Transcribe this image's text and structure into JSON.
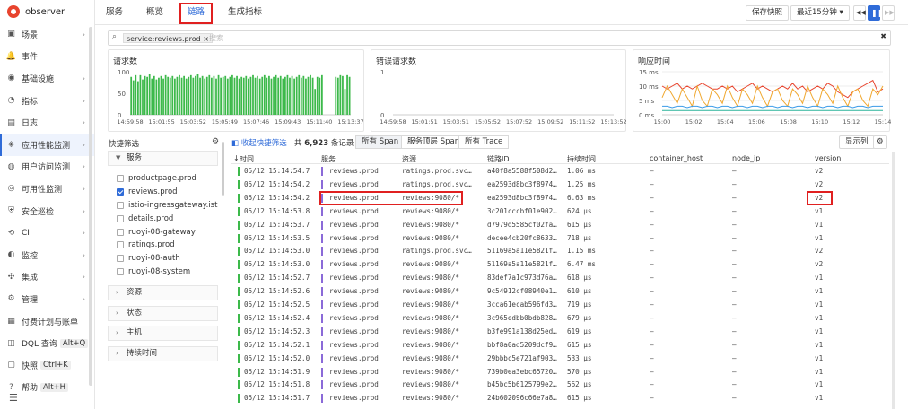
{
  "app": {
    "name": "observer"
  },
  "nav": {
    "items": [
      {
        "label": "场景",
        "icon": "dashboard-icon",
        "arrow": true
      },
      {
        "label": "事件",
        "icon": "bell-icon",
        "arrow": false
      },
      {
        "label": "基础设施",
        "icon": "server-icon",
        "arrow": true
      },
      {
        "label": "指标",
        "icon": "metric-icon",
        "arrow": true
      },
      {
        "label": "日志",
        "icon": "log-icon",
        "arrow": true
      },
      {
        "label": "应用性能监测",
        "icon": "apm-icon",
        "arrow": true,
        "active": true
      },
      {
        "label": "用户访问监测",
        "icon": "user-icon",
        "arrow": true
      },
      {
        "label": "可用性监测",
        "icon": "globe-icon",
        "arrow": true
      },
      {
        "label": "安全巡检",
        "icon": "shield-icon",
        "arrow": true
      },
      {
        "label": "CI",
        "icon": "ci-icon",
        "arrow": true
      },
      {
        "label": "监控",
        "icon": "monitor-icon",
        "arrow": true
      },
      {
        "label": "集成",
        "icon": "integration-icon",
        "arrow": true
      },
      {
        "label": "管理",
        "icon": "settings-icon",
        "arrow": true
      },
      {
        "label": "付费计划与账单",
        "icon": "billing-icon",
        "arrow": false
      },
      {
        "label": "DQL 查询",
        "icon": "dql-icon",
        "kbd": "Alt+Q"
      },
      {
        "label": "快照",
        "icon": "snapshot-icon",
        "kbd": "Ctrl+K"
      },
      {
        "label": "帮助",
        "icon": "help-icon",
        "kbd": "Alt+H"
      }
    ],
    "bottom_icon": "collapse-icon"
  },
  "tabs": [
    "服务",
    "概览",
    "链路",
    "生成指标"
  ],
  "active_tab": "链路",
  "toolbar": {
    "save_snapshot": "保存快照",
    "time_range": "最近15分钟"
  },
  "search": {
    "tag": "service:reviews.prod",
    "placeholder": "搜索"
  },
  "charts": {
    "requests": {
      "title": "请求数"
    },
    "errors": {
      "title": "错误请求数"
    },
    "latency": {
      "title": "响应时间"
    }
  },
  "chart_data": [
    {
      "type": "bar",
      "title": "请求数",
      "ylim": [
        0,
        100
      ],
      "yticks": [
        "100",
        "50",
        "0"
      ],
      "xticks": [
        "14:59:58",
        "15:01:55",
        "15:03:52",
        "15:05:49",
        "15:07:46",
        "15:09:43",
        "15:11:40",
        "15:13:37"
      ],
      "values": [
        88,
        80,
        92,
        78,
        92,
        82,
        90,
        88,
        95,
        84,
        90,
        82,
        86,
        90,
        84,
        92,
        88,
        86,
        90,
        84,
        88,
        92,
        86,
        90,
        84,
        88,
        92,
        86,
        90,
        94,
        86,
        90,
        84,
        88,
        92,
        86,
        90,
        84,
        92,
        86,
        88,
        90,
        84,
        88,
        92,
        86,
        90,
        84,
        88,
        86,
        90,
        84,
        88,
        92,
        86,
        90,
        84,
        88,
        92,
        86,
        90,
        84,
        88,
        92,
        86,
        90,
        84,
        88,
        92,
        86,
        90,
        84,
        88,
        92,
        86,
        90,
        84,
        88,
        92,
        86,
        60,
        88,
        86,
        92,
        0,
        0,
        0,
        0,
        0,
        88,
        86,
        92,
        90,
        60,
        92,
        88
      ],
      "color": "#3cb94a"
    },
    {
      "type": "bar",
      "title": "错误请求数",
      "ylim": [
        0,
        1
      ],
      "yticks": [
        "1",
        "0"
      ],
      "xticks": [
        "14:59:58",
        "15:01:51",
        "15:03:51",
        "15:05:52",
        "15:07:52",
        "15:09:52",
        "15:11:52",
        "15:13:52"
      ],
      "values": []
    },
    {
      "type": "line",
      "title": "响应时间",
      "ylim": [
        0,
        15
      ],
      "yticks": [
        "15 ms",
        "10 ms",
        "5 ms",
        "0 ms"
      ],
      "xticks": [
        "15:00",
        "15:02",
        "15:04",
        "15:06",
        "15:08",
        "15:10",
        "15:12",
        "15:14"
      ],
      "series": [
        {
          "color": "#e8442e",
          "values": [
            10,
            9,
            10,
            11,
            9,
            10,
            9,
            10,
            11,
            10,
            9,
            9,
            10,
            9,
            10,
            8,
            9,
            10,
            11,
            9,
            10,
            9,
            8,
            9,
            10,
            9,
            11,
            9,
            10,
            8,
            9,
            10,
            9,
            11,
            10,
            8,
            7,
            6,
            8,
            9,
            10,
            11,
            12,
            8,
            9
          ]
        },
        {
          "color": "#f0a830",
          "values": [
            6,
            10,
            7,
            4,
            9,
            6,
            3,
            10,
            5,
            3,
            9,
            7,
            4,
            10,
            6,
            3,
            9,
            7,
            4,
            10,
            6,
            3,
            8,
            9,
            5,
            3,
            9,
            7,
            4,
            10,
            6,
            3,
            9,
            7,
            4,
            10,
            6,
            3,
            8,
            9,
            5,
            3,
            9,
            7,
            10
          ]
        },
        {
          "color": "#3a9be8",
          "values": [
            3,
            3,
            2.5,
            3,
            3,
            2.5,
            3,
            3,
            2.5,
            3,
            3,
            2.5,
            3,
            3,
            2.5,
            3,
            3,
            2.5,
            3,
            3,
            2.5,
            3,
            3,
            2.5,
            3,
            3,
            2.5,
            3,
            3,
            2.5,
            3,
            3,
            2.5,
            3,
            3,
            2.5,
            3,
            3,
            2.5,
            3,
            3,
            2.5,
            3,
            3,
            3
          ]
        },
        {
          "color": "#2bb39a",
          "values": [
            1.5,
            1.5,
            1.5,
            1.5,
            1.5,
            1.5,
            1.5,
            1.5,
            1.5,
            1.5,
            1.5,
            1.5,
            1.5,
            1.5,
            1.5,
            1.5,
            1.5,
            1.5,
            1.5,
            1.5,
            1.5,
            1.5,
            1.5,
            1.5,
            1.5,
            1.5,
            1.5,
            1.5,
            1.5,
            1.5,
            1.5,
            1.5,
            1.5,
            1.5,
            1.5,
            1.5,
            1.5,
            1.5,
            1.5,
            1.5,
            1.5,
            1.5,
            1.5,
            1.5,
            1.5
          ]
        }
      ]
    }
  ],
  "filters": {
    "title": "快捷筛选",
    "service_group": "服务",
    "services": [
      {
        "label": "productpage.prod",
        "checked": false
      },
      {
        "label": "reviews.prod",
        "checked": true
      },
      {
        "label": "istio-ingressgateway.istio-sys",
        "checked": false
      },
      {
        "label": "details.prod",
        "checked": false
      },
      {
        "label": "ruoyi-08-gateway",
        "checked": false
      },
      {
        "label": "ratings.prod",
        "checked": false
      },
      {
        "label": "ruoyi-08-auth",
        "checked": false
      },
      {
        "label": "ruoyi-08-system",
        "checked": false
      }
    ],
    "groups": [
      "资源",
      "状态",
      "主机",
      "持续时间"
    ]
  },
  "table_toolbar": {
    "collapse_label": "收起快捷筛选",
    "count_prefix": "共",
    "count": "6,923",
    "count_suffix": "条记录",
    "segments": [
      "所有 Span",
      "服务顶层 Span",
      "所有 Trace"
    ],
    "columns_button": "显示列"
  },
  "table": {
    "columns": [
      "时间",
      "服务",
      "资源",
      "链路ID",
      "持续时间",
      "container_host",
      "node_ip",
      "version"
    ],
    "rows": [
      [
        "05/12 15:14:54.7",
        "reviews.prod",
        "ratings.prod.svc…",
        "a40f8a5588f508d2…",
        "1.06 ms",
        "–",
        "–",
        "v2"
      ],
      [
        "05/12 15:14:54.2",
        "reviews.prod",
        "ratings.prod.svc…",
        "ea2593d8bc3f8974…",
        "1.25 ms",
        "–",
        "–",
        "v2"
      ],
      [
        "05/12 15:14:54.2",
        "reviews.prod",
        "reviews:9080/*",
        "ea2593d8bc3f8974…",
        "6.63 ms",
        "–",
        "–",
        "v2"
      ],
      [
        "05/12 15:14:53.8",
        "reviews.prod",
        "reviews:9080/*",
        "3c201cccbf01e902…",
        "624 μs",
        "–",
        "–",
        "v1"
      ],
      [
        "05/12 15:14:53.7",
        "reviews.prod",
        "reviews:9080/*",
        "d7979d5585cf02fa…",
        "615 μs",
        "–",
        "–",
        "v1"
      ],
      [
        "05/12 15:14:53.5",
        "reviews.prod",
        "reviews:9080/*",
        "decee4cb20fc8633…",
        "718 μs",
        "–",
        "–",
        "v1"
      ],
      [
        "05/12 15:14:53.0",
        "reviews.prod",
        "ratings.prod.svc…",
        "51169a5a11e5821f…",
        "1.15 ms",
        "–",
        "–",
        "v2"
      ],
      [
        "05/12 15:14:53.0",
        "reviews.prod",
        "reviews:9080/*",
        "51169a5a11e5821f…",
        "6.47 ms",
        "–",
        "–",
        "v2"
      ],
      [
        "05/12 15:14:52.7",
        "reviews.prod",
        "reviews:9080/*",
        "83def7a1c973d76a…",
        "618 μs",
        "–",
        "–",
        "v1"
      ],
      [
        "05/12 15:14:52.6",
        "reviews.prod",
        "reviews:9080/*",
        "9c54912cf08940e1…",
        "610 μs",
        "–",
        "–",
        "v1"
      ],
      [
        "05/12 15:14:52.5",
        "reviews.prod",
        "reviews:9080/*",
        "3cca61ecab596fd3…",
        "719 μs",
        "–",
        "–",
        "v1"
      ],
      [
        "05/12 15:14:52.4",
        "reviews.prod",
        "reviews:9080/*",
        "3c965edbb0bdb828…",
        "679 μs",
        "–",
        "–",
        "v1"
      ],
      [
        "05/12 15:14:52.3",
        "reviews.prod",
        "reviews:9080/*",
        "b3fe991a138d25ed…",
        "619 μs",
        "–",
        "–",
        "v1"
      ],
      [
        "05/12 15:14:52.1",
        "reviews.prod",
        "reviews:9080/*",
        "bbf8a0ad5209dcf9…",
        "615 μs",
        "–",
        "–",
        "v1"
      ],
      [
        "05/12 15:14:52.0",
        "reviews.prod",
        "reviews:9080/*",
        "29bbbc5e721af903…",
        "533 μs",
        "–",
        "–",
        "v1"
      ],
      [
        "05/12 15:14:51.9",
        "reviews.prod",
        "reviews:9080/*",
        "739b0ea3ebc65720…",
        "570 μs",
        "–",
        "–",
        "v1"
      ],
      [
        "05/12 15:14:51.8",
        "reviews.prod",
        "reviews:9080/*",
        "b45bc5b6125799e2…",
        "562 μs",
        "–",
        "–",
        "v1"
      ],
      [
        "05/12 15:14:51.7",
        "reviews.prod",
        "reviews:9080/*",
        "24b602096c66e7a8…",
        "615 μs",
        "–",
        "–",
        "v1"
      ]
    ]
  }
}
